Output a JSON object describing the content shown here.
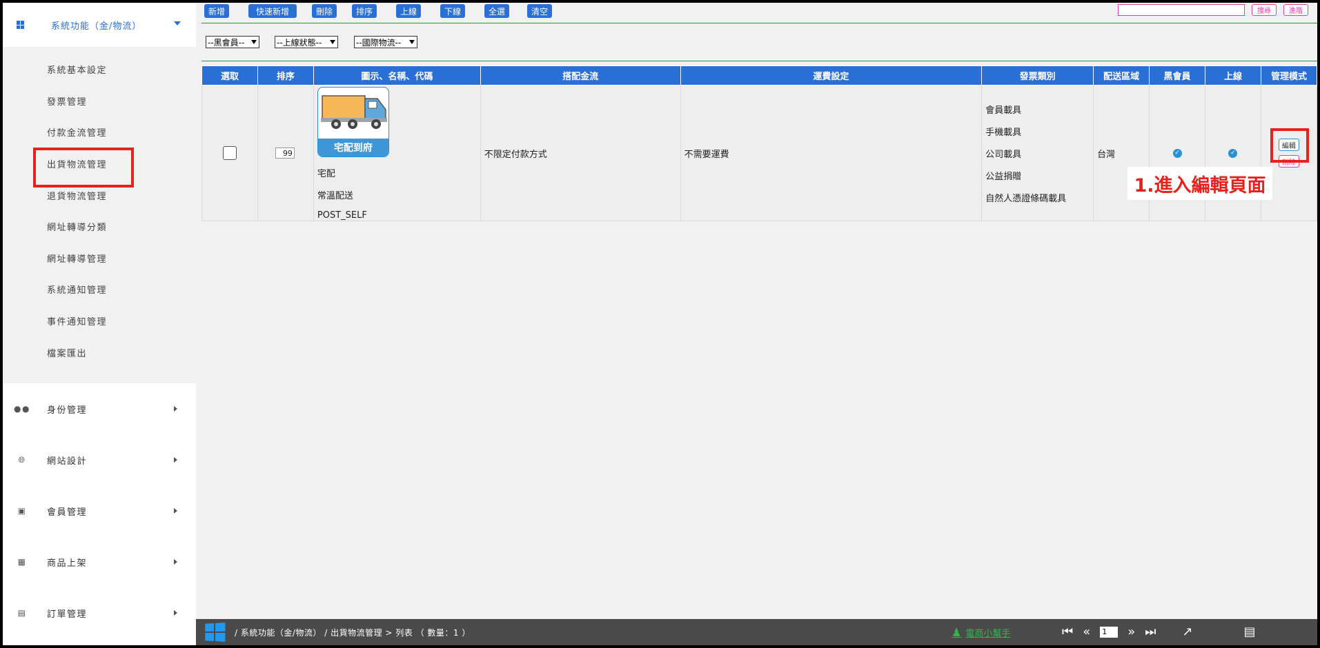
{
  "sidebar": {
    "header": "系統功能（金/物流）",
    "items": [
      {
        "label": "系統基本設定"
      },
      {
        "label": "發票管理"
      },
      {
        "label": "付款金流管理"
      },
      {
        "label": "出貨物流管理"
      },
      {
        "label": "退貨物流管理"
      },
      {
        "label": "網址轉導分類"
      },
      {
        "label": "網址轉導管理"
      },
      {
        "label": "系統通知管理"
      },
      {
        "label": "事件通知管理"
      },
      {
        "label": "檔案匯出"
      }
    ],
    "groups": [
      {
        "label": "身份管理",
        "icon": "users-icon"
      },
      {
        "label": "網站設計",
        "icon": "globe-icon"
      },
      {
        "label": "會員管理",
        "icon": "id-card-icon"
      },
      {
        "label": "商品上架",
        "icon": "boxes-icon"
      },
      {
        "label": "訂單管理",
        "icon": "scroll-icon"
      }
    ]
  },
  "toolbar": {
    "buttons": [
      "新增",
      "快速新增",
      "刪除",
      "排序",
      "上線",
      "下線",
      "全選",
      "清空"
    ],
    "search_placeholder": "",
    "search_label": "搜尋",
    "advanced_label": "進階"
  },
  "filters": [
    "--黑會員--",
    "--上線狀態--",
    "--國際物流--"
  ],
  "table": {
    "headers": [
      "選取",
      "排序",
      "圖示、名稱、代碼",
      "搭配金流",
      "運費設定",
      "發票類別",
      "配送區域",
      "黑會員",
      "上線",
      "管理模式"
    ],
    "rows": [
      {
        "sort": "99",
        "image_caption": "宅配到府",
        "name": "宅配",
        "sub_name": "常溫配送",
        "code": "POST_SELF",
        "payment": "不限定付款方式",
        "shipping_fee": "不需要運費",
        "invoice_types": [
          "會員載具",
          "手機載具",
          "公司載具",
          "公益捐贈",
          "自然人憑證條碼載具"
        ],
        "region": "台灣",
        "black_member": true,
        "online": true,
        "edit_label": "編輯",
        "delete_label": "刪除"
      }
    ]
  },
  "annotation": "1.進入編輯頁面",
  "footer": {
    "breadcrumb": "/  系統功能（金/物流）  /  出貨物流管理  >  列表 （ 數量：1 ）",
    "helper": "電商小幫手",
    "page": "1"
  },
  "colors": {
    "primary": "#2a6fd6",
    "highlight": "#e8211d",
    "accent_pink": "#e23cae",
    "green": "#1a9a3a"
  }
}
